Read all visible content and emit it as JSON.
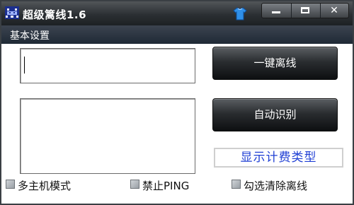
{
  "titlebar": {
    "title": "超级篱线1.6",
    "app_icon": "space-invader-icon",
    "skin_icon": "shirt-icon",
    "window_controls": {
      "minimize": "minimize-icon",
      "maximize": "maximize-icon",
      "close": "close-icon"
    }
  },
  "menu": {
    "items": [
      {
        "label": "基本设置"
      }
    ]
  },
  "buttons": {
    "one_click_offline": "一键离线",
    "auto_detect": "自动识别"
  },
  "fee_type_label": "显示计费类型",
  "checkboxes": [
    {
      "label": "多主机模式",
      "checked": false
    },
    {
      "label": "禁止PING",
      "checked": false
    },
    {
      "label": "勾选清除离线",
      "checked": false
    }
  ],
  "colors": {
    "fee_label_text": "#1f3fd4",
    "titlebar": "#2b2f33",
    "button": "#1a1d20"
  }
}
